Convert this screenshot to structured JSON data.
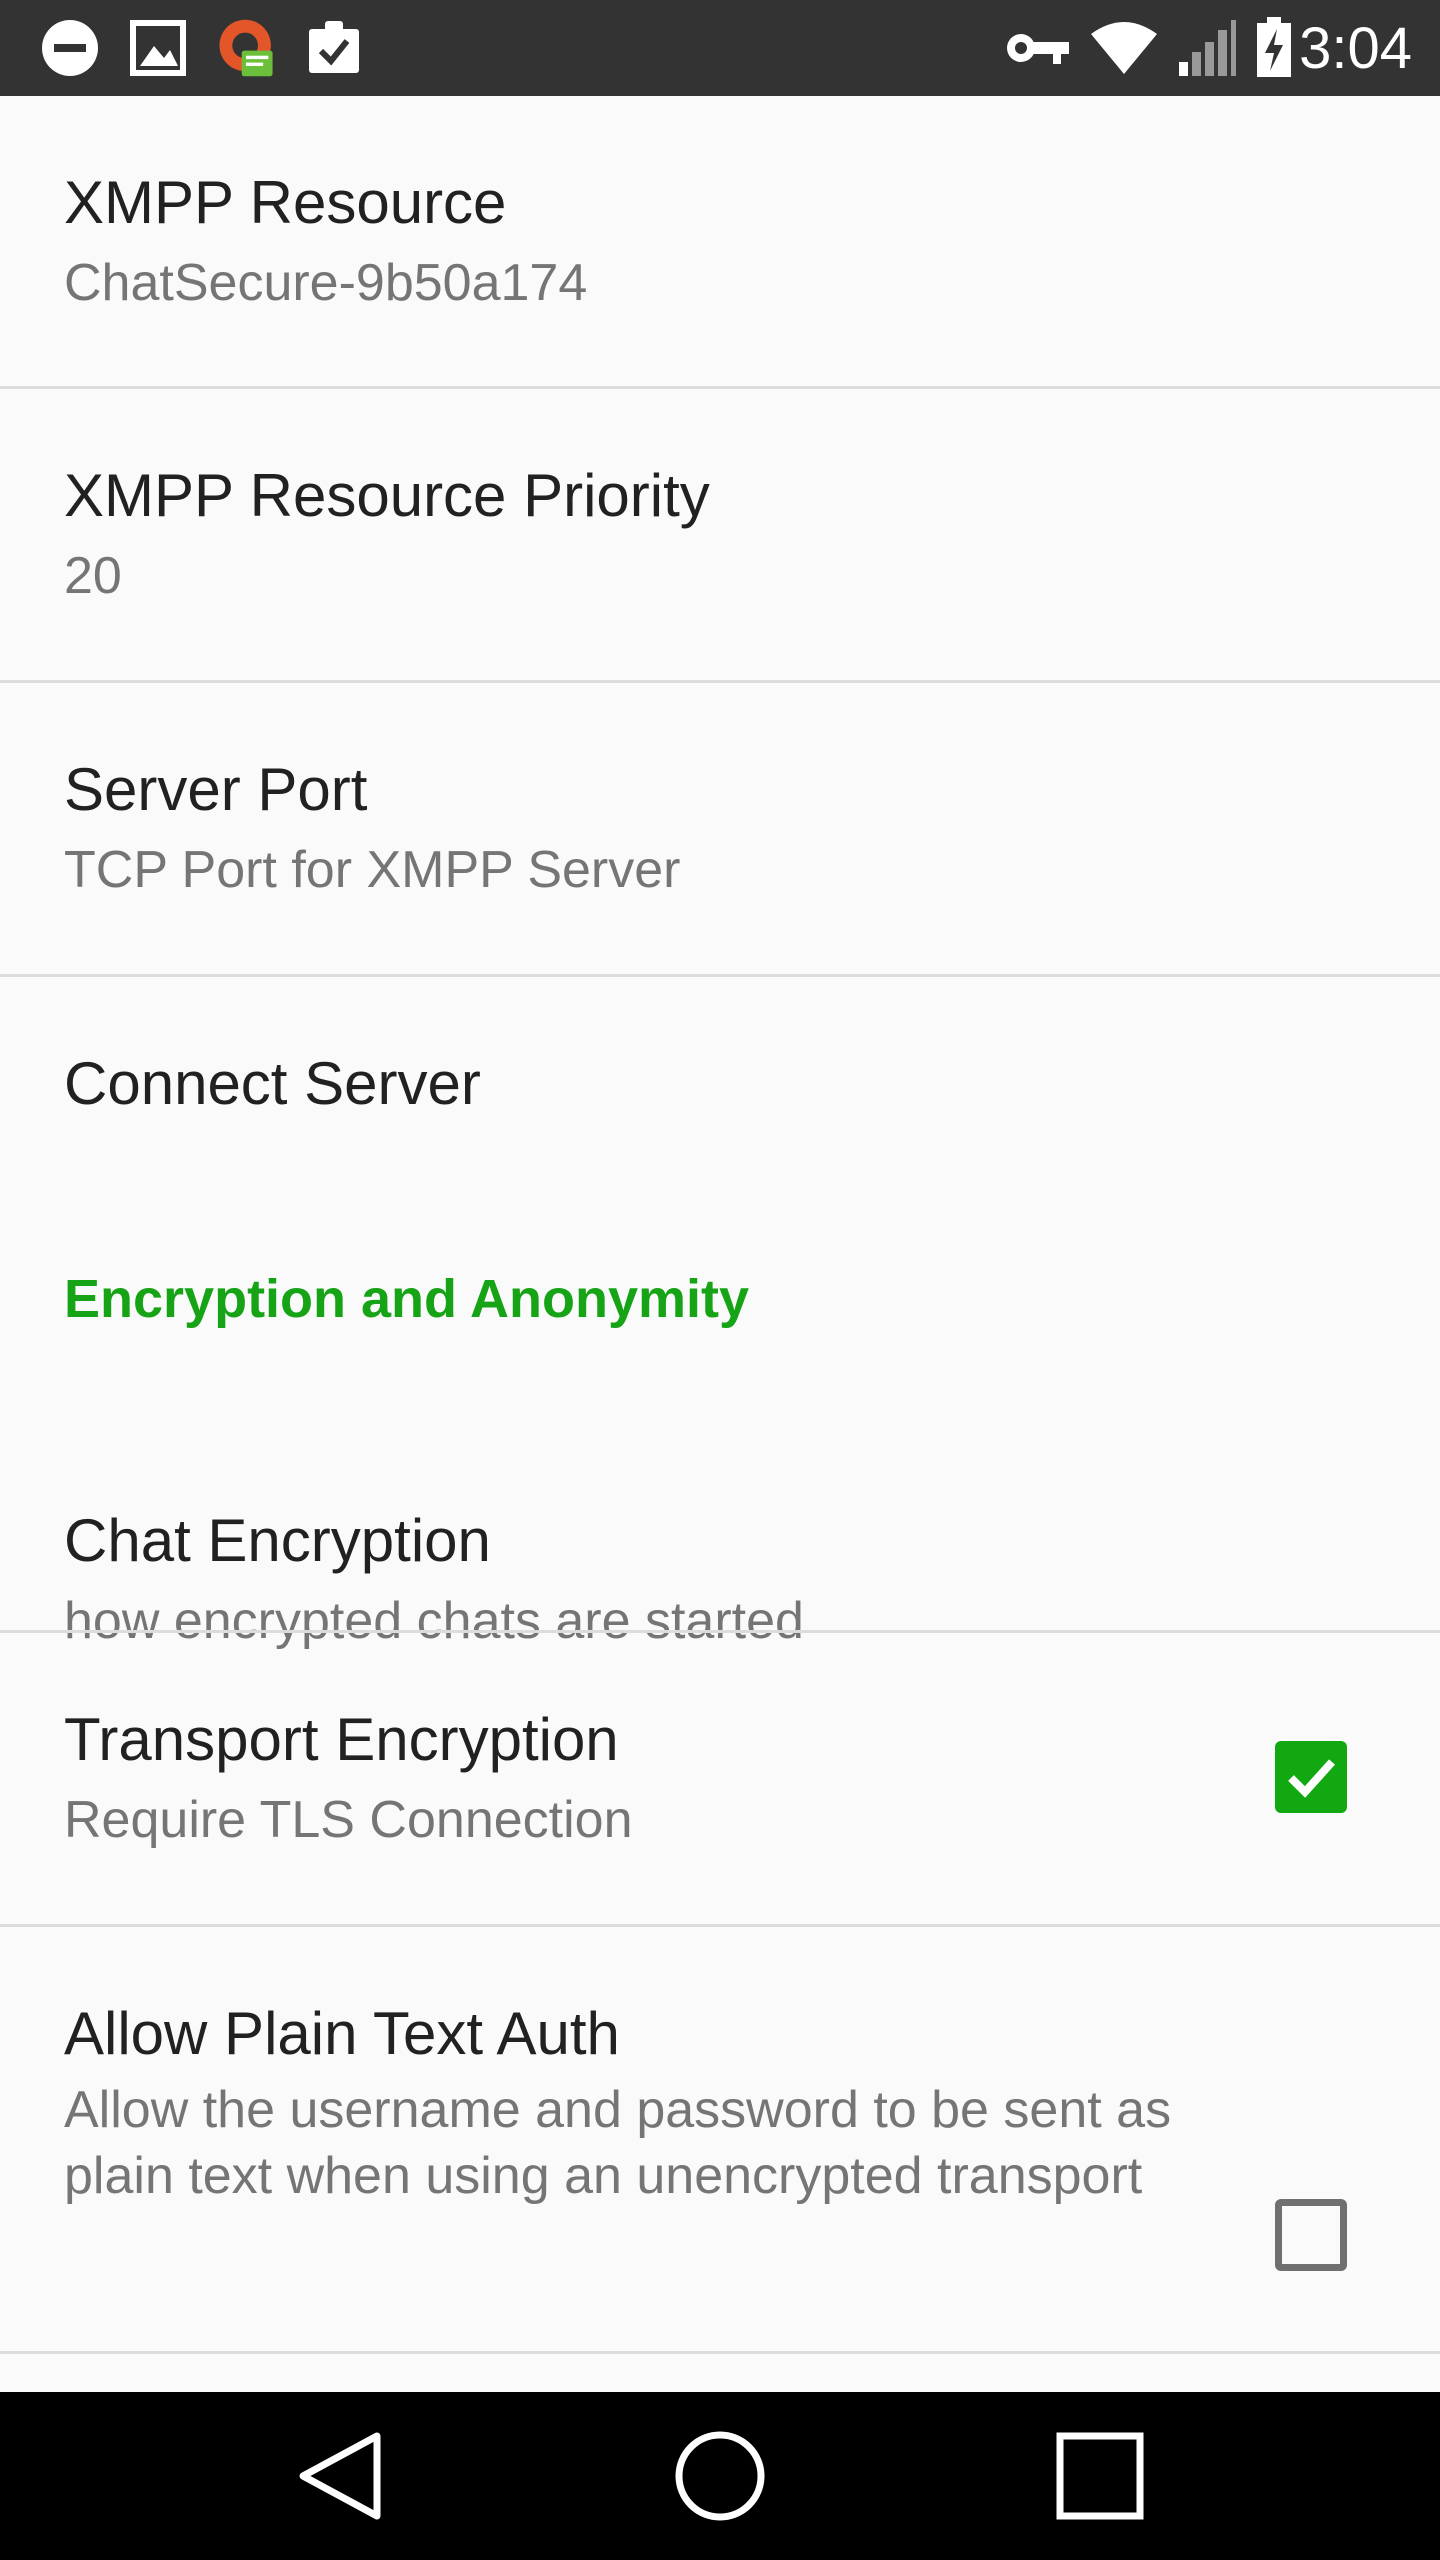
{
  "status_bar": {
    "time": "3:04",
    "left_icons": [
      "do-not-disturb-icon",
      "image-icon",
      "app-notification-icon",
      "clipboard-check-icon"
    ],
    "right_icons": [
      "vpn-key-icon",
      "wifi-icon",
      "cell-signal-icon",
      "battery-charging-icon"
    ]
  },
  "preferences": [
    {
      "title": "XMPP Resource",
      "summary": "ChatSecure-9b50a174"
    },
    {
      "title": "XMPP Resource Priority",
      "summary": "20"
    },
    {
      "title": "Server Port",
      "summary": "TCP Port for XMPP Server"
    },
    {
      "title": "Connect Server",
      "summary": ""
    },
    {
      "title": "Chat Encryption",
      "summary": "how encrypted chats are started"
    },
    {
      "title": "Transport Encryption",
      "summary": "Require TLS Connection",
      "checked": true
    },
    {
      "title": "Allow Plain Text Auth",
      "summary": "Allow the username and password to be sent as plain text when using an unencrypted transport",
      "checked": false
    }
  ],
  "categories": {
    "encryption": "Encryption and Anonymity"
  },
  "nav_bar": {
    "buttons": [
      "back-icon",
      "home-icon",
      "recents-icon"
    ]
  },
  "colors": {
    "accent": "#16a316",
    "status_bar": "#333333",
    "background": "#fafafa",
    "title_text": "#212121",
    "summary_text": "#757575"
  }
}
